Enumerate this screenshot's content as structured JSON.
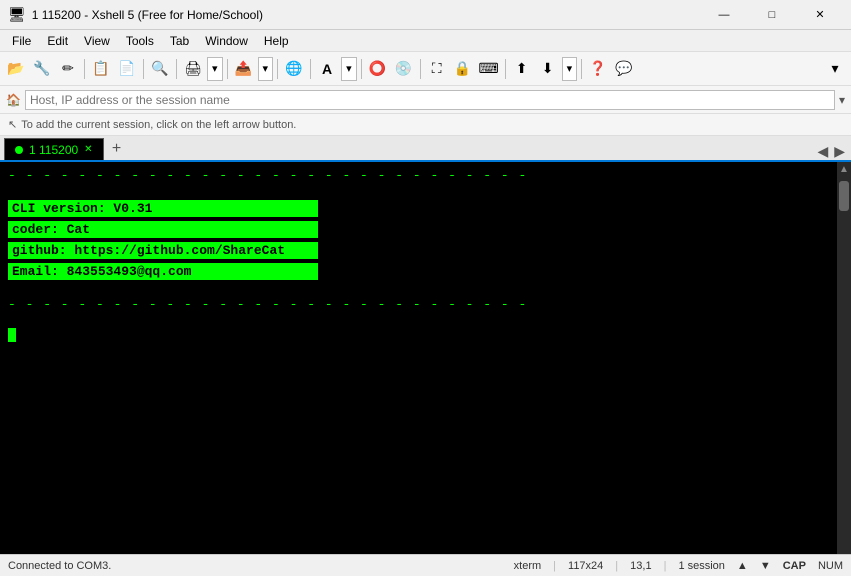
{
  "titlebar": {
    "icon": "🖥",
    "title": "1 115200 - Xshell 5 (Free for Home/School)",
    "minimize": "—",
    "maximize": "□",
    "close": "✕"
  },
  "menubar": {
    "items": [
      "File",
      "Edit",
      "View",
      "Tools",
      "Tab",
      "Window",
      "Help"
    ]
  },
  "toolbar": {
    "buttons": [
      "📂",
      "💾",
      "✂",
      "📋",
      "🔍",
      "🖨",
      "📤",
      "🌐",
      "A",
      "⭕",
      "💿",
      "⛶",
      "🔒",
      "⌨",
      "⬆",
      "⬇",
      "❓",
      "💬"
    ]
  },
  "addressbar": {
    "placeholder": "Host, IP address or the session name",
    "icon": "🏠"
  },
  "infobar": {
    "icon": "↖",
    "text": "To add the current session, click on the left arrow button."
  },
  "tabs": {
    "active": "1 115200",
    "items": [
      {
        "label": "1 115200",
        "active": true
      }
    ],
    "add_label": "+",
    "nav_prev": "◀",
    "nav_next": "▶"
  },
  "terminal": {
    "dashes": "- - - - - - - - - - - - - - - - - - - - - - - - - - - - - -",
    "rows": [
      {
        "label": "CLI version:",
        "value": "V0.31"
      },
      {
        "label": "coder:      ",
        "value": "Cat"
      },
      {
        "label": "github:     ",
        "value": "https://github.com/ShareCat"
      },
      {
        "label": "Email:      ",
        "value": "843553493@qq.com"
      }
    ],
    "dashes2": "- - - - - - - - - - - - - - - - - - - - - - - - - - - - - -"
  },
  "statusbar": {
    "connection": "Connected to COM3.",
    "term": "xterm",
    "size": "117x24",
    "cursor_pos": "13,1",
    "session": "1 session",
    "cap": "CAP",
    "num": "NUM"
  }
}
